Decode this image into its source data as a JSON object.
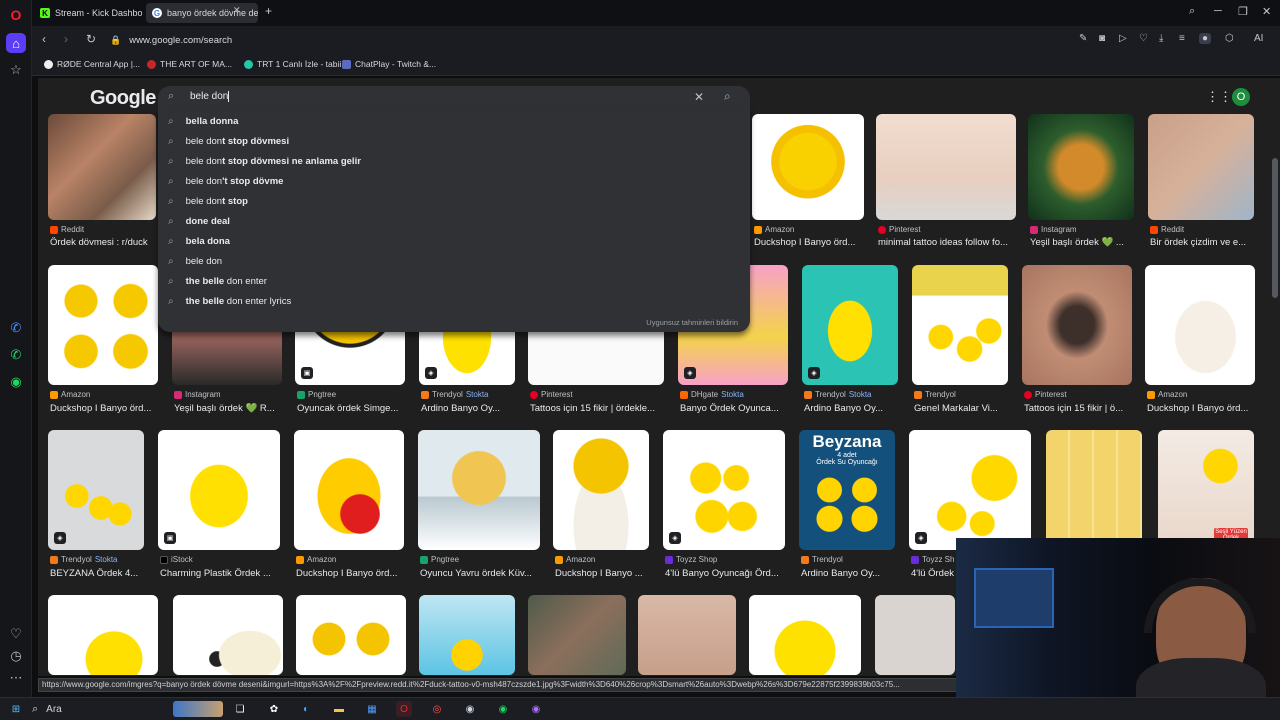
{
  "tabs": [
    {
      "label": "Stream - Kick Dashboard",
      "icon": "kick-icon"
    },
    {
      "label": "banyo ördek dövme deseni",
      "icon": "google-icon"
    }
  ],
  "address_bar": {
    "url": "www.google.com/search"
  },
  "bookmarks": [
    {
      "label": "RØDE Central App |...",
      "icon": "rode-icon"
    },
    {
      "label": "THE ART OF MA...",
      "icon": "bookmark-icon"
    },
    {
      "label": "TRT 1 Canlı İzle - tabii",
      "icon": "trt-icon"
    },
    {
      "label": "ChatPlay - Twitch &...",
      "icon": "chatplay-icon"
    }
  ],
  "google": {
    "logo": "Google",
    "search_value": "bele don",
    "avatar_letter": "O",
    "suggestions": [
      {
        "pre": "",
        "bold": "bella donna",
        "post": ""
      },
      {
        "pre": "bele don",
        "bold": "t stop dövmesi",
        "post": ""
      },
      {
        "pre": "bele don",
        "bold": "t stop dövmesi ne anlama gelir",
        "post": ""
      },
      {
        "pre": "bele don",
        "bold": "'t stop dövme",
        "post": ""
      },
      {
        "pre": "bele don",
        "bold": "t stop",
        "post": ""
      },
      {
        "pre": "",
        "bold": "done deal",
        "post": ""
      },
      {
        "pre": "",
        "bold": "bela dona",
        "post": ""
      },
      {
        "pre": "bele don",
        "bold": "",
        "post": ""
      },
      {
        "pre": "",
        "bold": "the belle",
        "post": " don enter"
      },
      {
        "pre": "",
        "bold": "the belle",
        "post": " don enter lyrics"
      }
    ],
    "suggest_footer": "Uygunsuz tahminleri bildirin"
  },
  "row1": [
    {
      "src": "Reddit",
      "cap": "Ördek dövmesi : r/duck"
    },
    {
      "src": "Amazon",
      "cap": "Duckshop I Banyo örd..."
    },
    {
      "src": "Pinterest",
      "cap": "minimal tattoo ideas follow fo..."
    },
    {
      "src": "Instagram",
      "cap": "Yeşil başlı ördek 💚 ..."
    },
    {
      "src": "Reddit",
      "cap": "Bir ördek çizdim ve e..."
    }
  ],
  "row2": [
    {
      "src": "Amazon",
      "stk": "",
      "cap": "Duckshop I Banyo örd..."
    },
    {
      "src": "Instagram",
      "stk": "",
      "cap": "Yeşil başlı ördek 💚 R..."
    },
    {
      "src": "Pngtree",
      "stk": "",
      "cap": "Oyuncak ördek Simge..."
    },
    {
      "src": "Trendyol",
      "stk": "Stokta",
      "cap": "Ardino Banyo Oy..."
    },
    {
      "src": "Pinterest",
      "stk": "",
      "cap": "Tattoos için 15 fikir | ördekle..."
    },
    {
      "src": "DHgate",
      "stk": "Stokta",
      "cap": "Banyo Ördek Oyunca..."
    },
    {
      "src": "Trendyol",
      "stk": "Stokta",
      "cap": "Ardino Banyo Oy..."
    },
    {
      "src": "Trendyol",
      "stk": "",
      "cap": "Genel Markalar Vi..."
    },
    {
      "src": "Pinterest",
      "stk": "",
      "cap": "Tattoos için 15 fikir | ö..."
    },
    {
      "src": "Amazon",
      "stk": "",
      "cap": "Duckshop I Banyo örd..."
    }
  ],
  "row3": [
    {
      "src": "Trendyol",
      "stk": "Stokta",
      "cap": "BEYZANA Ördek 4..."
    },
    {
      "src": "iStock",
      "stk": "",
      "cap": "Charming Plastik Ördek ..."
    },
    {
      "src": "Amazon",
      "stk": "",
      "cap": "Duckshop I Banyo örd..."
    },
    {
      "src": "Pngtree",
      "stk": "",
      "cap": "Oyuncu Yavru ördek Küv..."
    },
    {
      "src": "Amazon",
      "stk": "",
      "cap": "Duckshop I Banyo ..."
    },
    {
      "src": "Toyzz Shop",
      "stk": "",
      "cap": "4'lü Banyo Oyuncağı Örd..."
    },
    {
      "src": "Trendyol",
      "stk": "",
      "cap": "Ardino Banyo Oy..."
    },
    {
      "src": "Toyzz Sh",
      "stk": "",
      "cap": "4'lü Ördek"
    }
  ],
  "beyzana_thumb": {
    "title": "Beyzana",
    "line1": "4 adet",
    "line2": "Ördek Su Oyuncağı"
  },
  "sesli_badge": "Sesli Yüzen Ördek",
  "status_url": "https://www.google.com/imgres?q=banyo ördek dövme deseni&imgurl=https%3A%2F%2Fpreview.redd.it%2Fduck-tattoo-v0-msh487czszde1.jpg%3Fwidth%3D640%26crop%3Dsmart%26auto%3Dwebp%26s%3D679e22875f2399839b03c75...",
  "taskbar": {
    "search_label": "Ara"
  }
}
